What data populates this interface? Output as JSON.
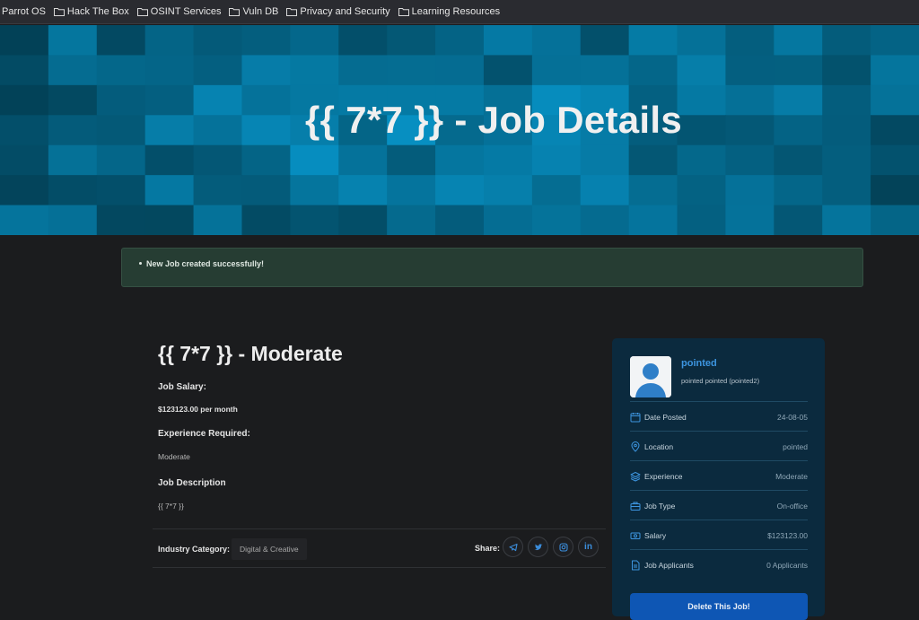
{
  "bookmarks": [
    {
      "label": "Parrot OS",
      "folder": false
    },
    {
      "label": "Hack The Box",
      "folder": true
    },
    {
      "label": "OSINT Services",
      "folder": true
    },
    {
      "label": "Vuln DB",
      "folder": true
    },
    {
      "label": "Privacy and Security",
      "folder": true
    },
    {
      "label": "Learning Resources",
      "folder": true
    }
  ],
  "hero": {
    "title": "{{ 7*7 }} - Job Details"
  },
  "alert": {
    "message": "New Job created successfully!"
  },
  "job": {
    "title": "{{ 7*7 }} - Moderate",
    "salary_label": "Job Salary:",
    "salary_value": "$123123.00 per month",
    "experience_label": "Experience Required:",
    "experience_value": "Moderate",
    "description_label": "Job Description",
    "description_value": "{{ 7*7 }}",
    "industry_label": "Industry Category:",
    "industry_value": "Digital & Creative",
    "share_label": "Share:"
  },
  "poster": {
    "name": "pointed",
    "subtitle": "pointed pointed (pointed2)"
  },
  "summary": [
    {
      "icon": "calendar-icon",
      "label": "Date Posted",
      "value": "24-08-05"
    },
    {
      "icon": "location-pin-icon",
      "label": "Location",
      "value": "pointed"
    },
    {
      "icon": "layers-icon",
      "label": "Experience",
      "value": "Moderate"
    },
    {
      "icon": "briefcase-icon",
      "label": "Job Type",
      "value": "On-office"
    },
    {
      "icon": "money-icon",
      "label": "Salary",
      "value": "$123123.00"
    },
    {
      "icon": "document-icon",
      "label": "Job Applicants",
      "value": "0 Applicants"
    }
  ],
  "actions": {
    "delete_label": "Delete This Job!"
  },
  "colors": {
    "accent": "#3d95e0",
    "button": "#0e56b4",
    "card": "#0b2a3e",
    "alert_bg": "#263d33"
  }
}
